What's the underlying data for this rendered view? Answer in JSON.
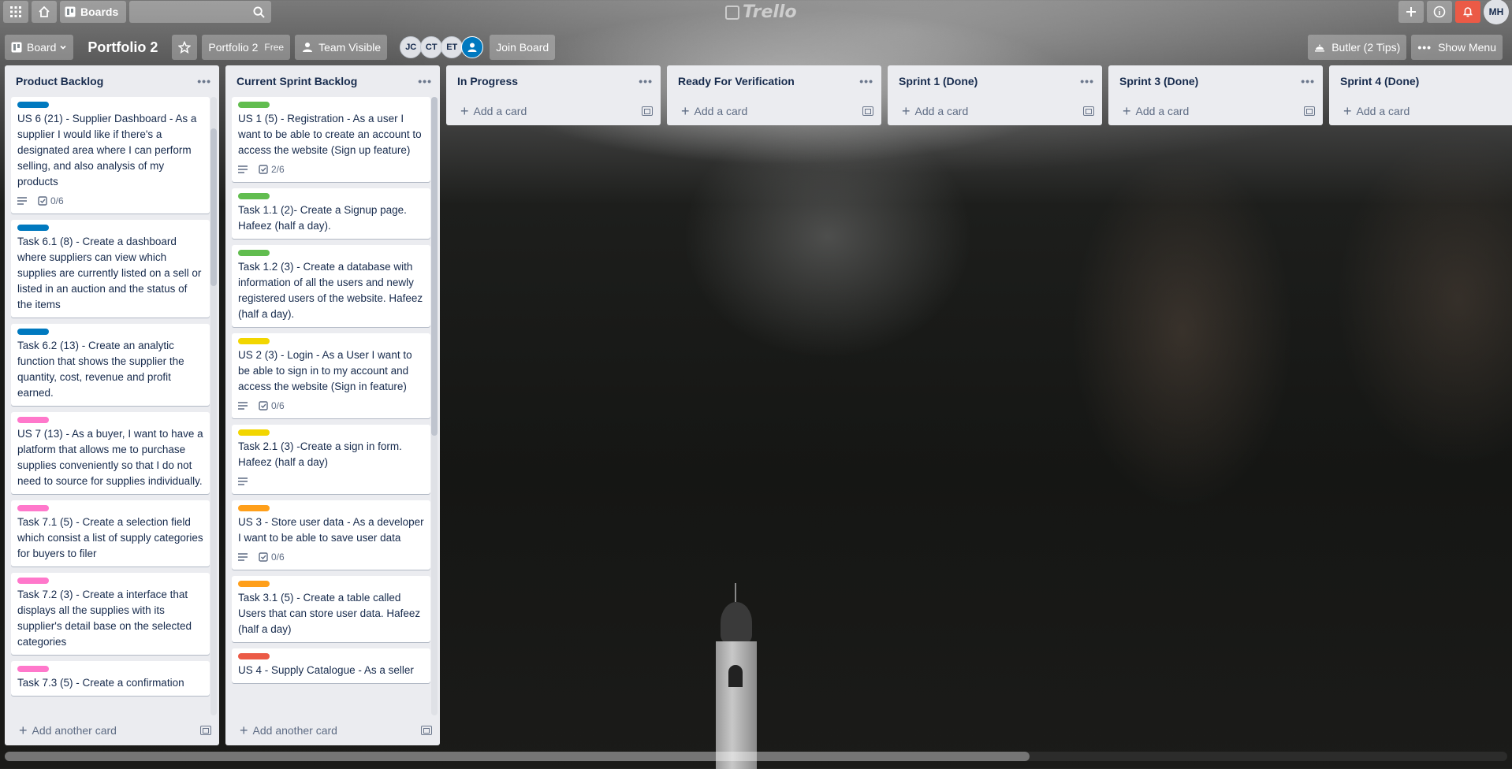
{
  "topbar": {
    "boards_label": "Boards",
    "logo_text": "Trello"
  },
  "board": {
    "view_label": "Board",
    "title": "Portfolio 2",
    "team_name": "Portfolio 2",
    "plan": "Free",
    "visibility": "Team Visible",
    "members": [
      "JC",
      "CT",
      "ET"
    ],
    "join_label": "Join Board",
    "butler_label": "Butler (2 Tips)",
    "menu_label": "Show Menu",
    "user_initials": "MH"
  },
  "colors": {
    "blue": "#0079bf",
    "green": "#61bd4f",
    "pink": "#ff78cb",
    "yellow": "#f2d600",
    "orange": "#ff9f1a",
    "red": "#eb5a46"
  },
  "lists": [
    {
      "title": "Product Backlog",
      "add_label": "Add another card",
      "cards": [
        {
          "label": "blue",
          "text": "US 6 (21) - Supplier Dashboard - As a supplier I would like if there's a designated area where I can perform selling, and also analysis of my products",
          "desc": true,
          "checklist": "0/6"
        },
        {
          "label": "blue",
          "text": "Task 6.1 (8) - Create a dashboard where suppliers can view which supplies are currently listed on a sell or listed in an auction and the status of the items"
        },
        {
          "label": "blue",
          "text": "Task 6.2 (13) - Create an analytic function that shows the supplier the quantity, cost, revenue and profit earned."
        },
        {
          "label": "pink",
          "text": "US 7 (13) - As a buyer, I want to have a platform that allows me to purchase supplies conveniently so that I do not need to source for supplies individually."
        },
        {
          "label": "pink",
          "text": "Task 7.1 (5) - Create a selection field which consist a list of supply categories for buyers to filer"
        },
        {
          "label": "pink",
          "text": "Task 7.2 (3) - Create a interface that displays all the supplies with its supplier's detail base on the selected categories"
        },
        {
          "label": "pink",
          "text": "Task 7.3 (5) - Create a confirmation"
        }
      ]
    },
    {
      "title": "Current Sprint Backlog",
      "add_label": "Add another card",
      "cards": [
        {
          "label": "green",
          "text": "US 1 (5) - Registration - As a user I want to be able to create an account to access the website (Sign up feature)",
          "desc": true,
          "checklist": "2/6"
        },
        {
          "label": "green",
          "text": "Task 1.1 (2)- Create a Signup page. Hafeez (half a day)."
        },
        {
          "label": "green",
          "text": "Task 1.2 (3) - Create a database with information of all the users and newly registered users of the website. Hafeez (half a day)."
        },
        {
          "label": "yellow",
          "text": "US 2 (3) - Login - As a User I want to be able to sign in to my account and access the website (Sign in feature)",
          "desc": true,
          "checklist": "0/6"
        },
        {
          "label": "yellow",
          "text": "Task 2.1 (3) -Create a sign in form. Hafeez (half a day)",
          "desc": true
        },
        {
          "label": "orange",
          "text": "US 3 - Store user data - As a developer I want to be able to save user data",
          "desc": true,
          "checklist": "0/6"
        },
        {
          "label": "orange",
          "text": "Task 3.1 (5) - Create a table called Users that can store user data. Hafeez (half a day)"
        },
        {
          "label": "red",
          "text": "US 4 - Supply Catalogue - As a seller"
        }
      ]
    },
    {
      "title": "In Progress",
      "add_label": "Add a card",
      "cards": []
    },
    {
      "title": "Ready For Verification",
      "add_label": "Add a card",
      "cards": []
    },
    {
      "title": "Sprint 1 (Done)",
      "add_label": "Add a card",
      "cards": []
    },
    {
      "title": "Sprint 3 (Done)",
      "add_label": "Add a card",
      "cards": []
    },
    {
      "title": "Sprint 4 (Done)",
      "add_label": "Add a card",
      "cards": []
    }
  ]
}
